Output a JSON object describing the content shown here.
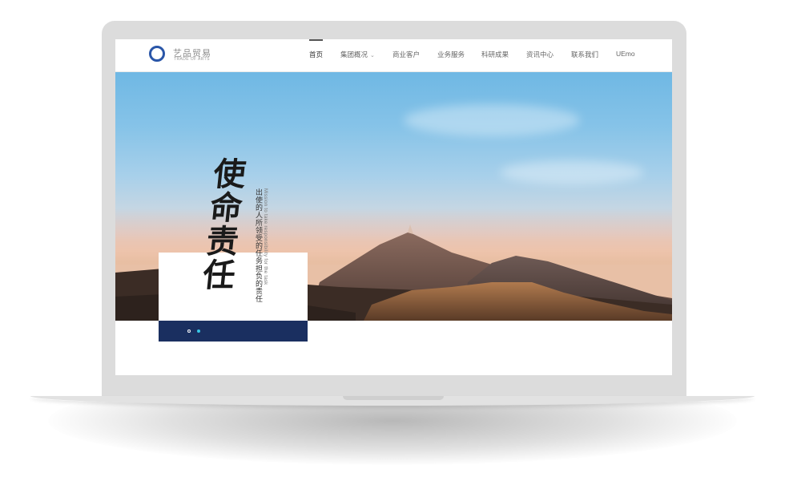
{
  "site": {
    "logo_cn": "艺品贸易",
    "logo_en": "TRADE OF ARTS"
  },
  "nav": {
    "items": [
      {
        "label": "首页",
        "active": true
      },
      {
        "label": "集团概况",
        "has_dropdown": true
      },
      {
        "label": "商业客户"
      },
      {
        "label": "业务服务"
      },
      {
        "label": "科研成果"
      },
      {
        "label": "资讯中心"
      },
      {
        "label": "联系我们"
      },
      {
        "label": "UEmo"
      }
    ]
  },
  "banner": {
    "calligraphy": [
      "使",
      "命",
      "责",
      "任"
    ],
    "subtitle_cn": "出使的人所领受的任务担负的责任",
    "subtitle_en": "Mission to take responsibility for the task",
    "slides_total": 2,
    "slide_active": 2
  },
  "colors": {
    "brand_blue": "#2a56a8",
    "caption_bar": "#1a2f60",
    "active_dot": "#38c7e6"
  }
}
